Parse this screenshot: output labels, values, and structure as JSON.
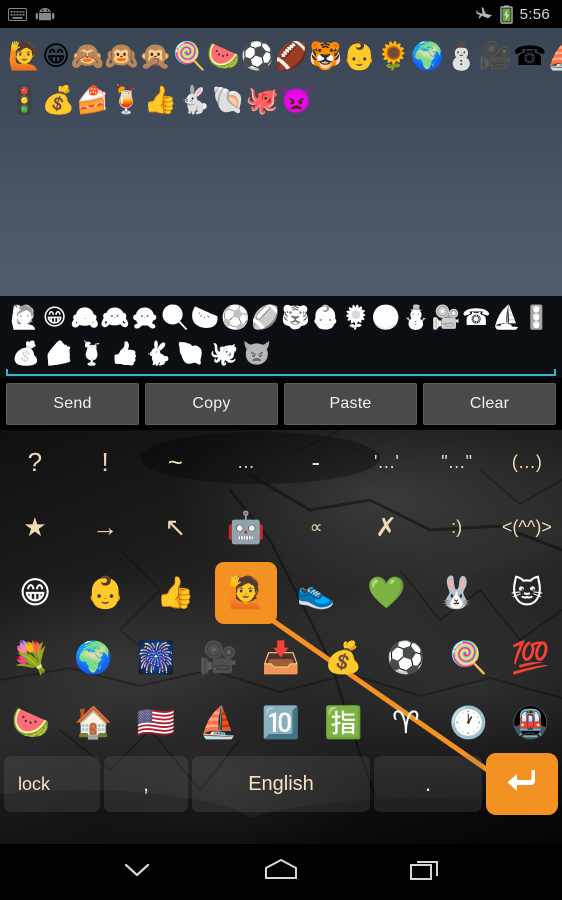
{
  "statusbar": {
    "left_icons": [
      {
        "name": "keyboard-icon",
        "glyph": "⌨"
      },
      {
        "name": "android-robot-icon",
        "glyph": "🤖"
      }
    ],
    "right_icons": [
      {
        "name": "airplane-mode-icon",
        "glyph": "✈"
      },
      {
        "name": "battery-charging-icon",
        "glyph": "🔋"
      }
    ],
    "time": "5:56"
  },
  "preview": {
    "name": "emoji-preview-panel",
    "rows": [
      [
        {
          "name": "emoji-happy-person-raising-hand",
          "glyph": "🙋"
        },
        {
          "name": "emoji-grinning-face",
          "glyph": "😁"
        },
        {
          "name": "emoji-see-no-evil-monkey",
          "glyph": "🙈"
        },
        {
          "name": "emoji-hear-no-evil-monkey",
          "glyph": "🙉"
        },
        {
          "name": "emoji-speak-no-evil-monkey",
          "glyph": "🙊"
        },
        {
          "name": "emoji-lollipop",
          "glyph": "🍭"
        },
        {
          "name": "emoji-watermelon",
          "glyph": "🍉"
        },
        {
          "name": "emoji-soccer-ball",
          "glyph": "⚽"
        },
        {
          "name": "emoji-american-football",
          "glyph": "🏈"
        },
        {
          "name": "emoji-tiger-face",
          "glyph": "🐯"
        },
        {
          "name": "emoji-baby",
          "glyph": "👶"
        },
        {
          "name": "emoji-sunflower",
          "glyph": "🌻"
        },
        {
          "name": "emoji-earth-globe",
          "glyph": "🌍"
        },
        {
          "name": "emoji-snowman",
          "glyph": "⛄"
        },
        {
          "name": "emoji-movie-camera",
          "glyph": "🎥"
        },
        {
          "name": "emoji-telephone",
          "glyph": "☎"
        },
        {
          "name": "emoji-sailboat",
          "glyph": "⛵"
        }
      ],
      [
        {
          "name": "emoji-vertical-traffic-light",
          "glyph": "🚦"
        },
        {
          "name": "emoji-money-bag",
          "glyph": "💰"
        },
        {
          "name": "emoji-shortcake",
          "glyph": "🍰"
        },
        {
          "name": "emoji-tropical-drink",
          "glyph": "🍹"
        },
        {
          "name": "emoji-thumbs-up",
          "glyph": "👍"
        },
        {
          "name": "emoji-rabbit",
          "glyph": "🐇"
        },
        {
          "name": "emoji-spiral-shell",
          "glyph": "🐚"
        },
        {
          "name": "emoji-octopus",
          "glyph": "🐙"
        },
        {
          "name": "emoji-imp",
          "glyph": "👿"
        }
      ]
    ]
  },
  "editfield": {
    "name": "emoji-text-input",
    "rows": [
      [
        {
          "name": "emoji-happy-person-raising-hand",
          "glyph": "🙋"
        },
        {
          "name": "emoji-grinning-face",
          "glyph": "😁"
        },
        {
          "name": "emoji-see-no-evil-monkey",
          "glyph": "🙈"
        },
        {
          "name": "emoji-hear-no-evil-monkey",
          "glyph": "🙉"
        },
        {
          "name": "emoji-speak-no-evil-monkey",
          "glyph": "🙊"
        },
        {
          "name": "emoji-lollipop",
          "glyph": "🍭"
        },
        {
          "name": "emoji-watermelon",
          "glyph": "🍉"
        },
        {
          "name": "emoji-soccer-ball",
          "glyph": "⚽"
        },
        {
          "name": "emoji-american-football",
          "glyph": "🏈"
        },
        {
          "name": "emoji-tiger-face",
          "glyph": "🐯"
        },
        {
          "name": "emoji-baby",
          "glyph": "👶"
        },
        {
          "name": "emoji-sunflower",
          "glyph": "🌻"
        },
        {
          "name": "emoji-earth-globe",
          "glyph": "🌍"
        },
        {
          "name": "emoji-snowman",
          "glyph": "⛄"
        },
        {
          "name": "emoji-movie-camera",
          "glyph": "🎥"
        },
        {
          "name": "emoji-telephone",
          "glyph": "☎"
        },
        {
          "name": "emoji-sailboat",
          "glyph": "⛵"
        },
        {
          "name": "emoji-vertical-traffic-light",
          "glyph": "🚦"
        }
      ],
      [
        {
          "name": "emoji-money-bag",
          "glyph": "💰"
        },
        {
          "name": "emoji-shortcake",
          "glyph": "🍰"
        },
        {
          "name": "emoji-tropical-drink",
          "glyph": "🍹"
        },
        {
          "name": "emoji-thumbs-up",
          "glyph": "👍"
        },
        {
          "name": "emoji-rabbit",
          "glyph": "🐇"
        },
        {
          "name": "emoji-spiral-shell",
          "glyph": "🐚"
        },
        {
          "name": "emoji-octopus",
          "glyph": "🐙"
        },
        {
          "name": "emoji-imp",
          "glyph": "👿"
        }
      ]
    ],
    "focus_color": "#33b5c9"
  },
  "actions": {
    "name": "action-button-row",
    "buttons": [
      {
        "name": "send-button",
        "label": "Send"
      },
      {
        "name": "copy-button",
        "label": "Copy"
      },
      {
        "name": "paste-button",
        "label": "Paste"
      },
      {
        "name": "clear-button",
        "label": "Clear"
      }
    ]
  },
  "keyboard": {
    "accent_color": "#f39122",
    "key_text_color": "#f2d9b4",
    "selected_key": "emoji-happy-person-raising-hand",
    "rows": [
      {
        "name": "symbol-row-1",
        "keys": [
          {
            "name": "key-question-mark",
            "label": "?",
            "type": "sym"
          },
          {
            "name": "key-exclamation-mark",
            "label": "!",
            "type": "sym"
          },
          {
            "name": "key-tilde",
            "label": "~",
            "type": "sym"
          },
          {
            "name": "key-ellipsis",
            "label": "…",
            "type": "small"
          },
          {
            "name": "key-hyphen",
            "label": "-",
            "type": "sym"
          },
          {
            "name": "key-single-quotes",
            "label": "'…'",
            "type": "small"
          },
          {
            "name": "key-double-quotes",
            "label": "\"…\"",
            "type": "small"
          },
          {
            "name": "key-parentheses",
            "label": "(…)",
            "type": "small"
          }
        ]
      },
      {
        "name": "symbol-row-2",
        "keys": [
          {
            "name": "key-star",
            "label": "★",
            "type": "sym"
          },
          {
            "name": "key-arrow-right",
            "label": "→",
            "type": "sym"
          },
          {
            "name": "key-arrow-upper-left",
            "label": "↖",
            "type": "sym"
          },
          {
            "name": "key-android-robot",
            "label": "🤖",
            "type": "em"
          },
          {
            "name": "key-proportional-to",
            "label": "∝",
            "type": "small"
          },
          {
            "name": "key-ballot-x",
            "label": "✗",
            "type": "sym"
          },
          {
            "name": "key-smiley-kaomoji",
            "label": ":)",
            "type": "small"
          },
          {
            "name": "key-cat-kaomoji",
            "label": "<(^^)>",
            "type": "small"
          }
        ]
      },
      {
        "name": "emoji-row-1",
        "keys": [
          {
            "name": "key-emoji-grinning-face",
            "label": "😁",
            "type": "em"
          },
          {
            "name": "key-emoji-baby",
            "label": "👶",
            "type": "em"
          },
          {
            "name": "key-emoji-thumbs-up",
            "label": "👍",
            "type": "em"
          },
          {
            "name": "key-emoji-happy-person-raising-hand",
            "label": "🙋",
            "type": "em",
            "selected": true
          },
          {
            "name": "key-emoji-athletic-shoe",
            "label": "👟",
            "type": "em"
          },
          {
            "name": "key-emoji-green-heart",
            "label": "💚",
            "type": "em"
          },
          {
            "name": "key-emoji-rabbit-face",
            "label": "🐰",
            "type": "em"
          },
          {
            "name": "key-emoji-cat-face",
            "label": "🐱",
            "type": "em"
          }
        ]
      },
      {
        "name": "emoji-row-2",
        "keys": [
          {
            "name": "key-emoji-bouquet",
            "label": "💐",
            "type": "em"
          },
          {
            "name": "key-emoji-earth-globe",
            "label": "🌍",
            "type": "em"
          },
          {
            "name": "key-emoji-firework-sparkler",
            "label": "🎆",
            "type": "em"
          },
          {
            "name": "key-emoji-movie-camera",
            "label": "🎥",
            "type": "em"
          },
          {
            "name": "key-emoji-inbox-tray",
            "label": "📥",
            "type": "em"
          },
          {
            "name": "key-emoji-money-bag",
            "label": "💰",
            "type": "em"
          },
          {
            "name": "key-emoji-soccer-ball",
            "label": "⚽",
            "type": "em"
          },
          {
            "name": "key-emoji-lollipop",
            "label": "🍭",
            "type": "em"
          },
          {
            "name": "key-emoji-hundred-points",
            "label": "💯",
            "type": "em"
          }
        ]
      },
      {
        "name": "emoji-row-3",
        "keys": [
          {
            "name": "key-emoji-watermelon",
            "label": "🍉",
            "type": "em"
          },
          {
            "name": "key-emoji-house",
            "label": "🏠",
            "type": "em"
          },
          {
            "name": "key-emoji-us-flag",
            "label": "🇺🇸",
            "type": "em"
          },
          {
            "name": "key-emoji-sailboat",
            "label": "⛵",
            "type": "em"
          },
          {
            "name": "key-emoji-keycap-ten",
            "label": "🔟",
            "type": "em"
          },
          {
            "name": "key-emoji-japanese-reserved-button",
            "label": "🈯",
            "type": "em"
          },
          {
            "name": "key-emoji-aries",
            "label": "♈",
            "type": "em"
          },
          {
            "name": "key-emoji-clock-face",
            "label": "🕐",
            "type": "em"
          },
          {
            "name": "key-emoji-metro",
            "label": "🚇",
            "type": "em"
          }
        ]
      }
    ],
    "bottom_row": {
      "name": "keyboard-bottom-row",
      "lock_label": "lock",
      "comma_label": ",",
      "space_label": "English",
      "period_label": ".",
      "enter_icon": "return-arrow-icon"
    }
  },
  "navbar": {
    "name": "android-navigation-bar",
    "buttons": [
      {
        "name": "hide-keyboard-button",
        "icon": "chevron-down-icon"
      },
      {
        "name": "home-button",
        "icon": "home-pentagon-icon"
      },
      {
        "name": "recents-button",
        "icon": "recent-apps-icon"
      }
    ]
  }
}
